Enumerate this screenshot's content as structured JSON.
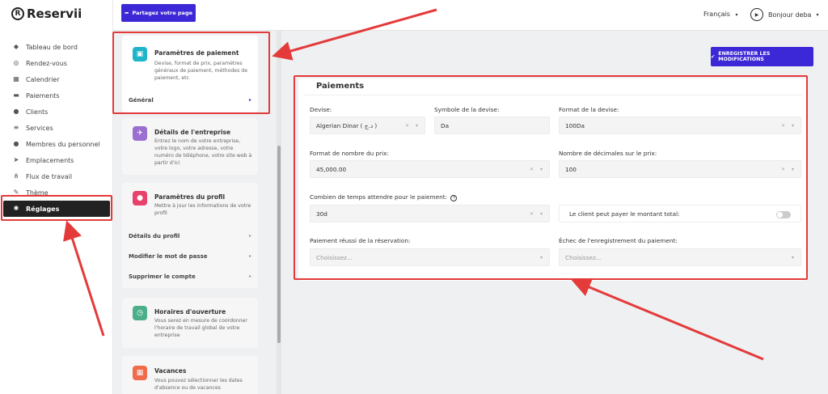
{
  "app": {
    "logo_text": "Reservii",
    "logo_mark": "R"
  },
  "sidebar": {
    "items": [
      {
        "label": "Tableau de bord",
        "icon": "cube-icon"
      },
      {
        "label": "Rendez-vous",
        "icon": "headset-icon"
      },
      {
        "label": "Calendrier",
        "icon": "calendar-icon"
      },
      {
        "label": "Paiements",
        "icon": "card-icon"
      },
      {
        "label": "Clients",
        "icon": "users-icon"
      },
      {
        "label": "Services",
        "icon": "list-icon"
      },
      {
        "label": "Membres du personnel",
        "icon": "user-icon"
      },
      {
        "label": "Emplacements",
        "icon": "location-icon"
      },
      {
        "label": "Flux de travail",
        "icon": "flow-icon"
      },
      {
        "label": "Thème",
        "icon": "brush-icon"
      },
      {
        "label": "Réglages",
        "icon": "gear-icon",
        "active": true
      }
    ]
  },
  "topbar": {
    "share_label": "Partagez votre page",
    "language": "Français",
    "greeting": "Bonjour deba"
  },
  "settings": {
    "payment": {
      "title": "Paramètres de paiement",
      "desc": "Devise, format de prix, paramètres généraux de paiement, méthodes de paiement, etc",
      "sub": "Général"
    },
    "company": {
      "title": "Détails de l'entreprise",
      "desc": "Entrez le nom de votre entreprise, votre logo, votre adresse, votre numéro de téléphone, votre site web à partir d'ici"
    },
    "profile": {
      "title": "Paramètres du profil",
      "desc": "Mettre à jour les informations de votre profil",
      "subs": [
        "Détails du profil",
        "Modifier le mot de passe",
        "Supprimer le compte"
      ]
    },
    "hours": {
      "title": "Horaires d'ouverture",
      "desc": "Vous serez en mesure de coordonner l'horaire de travail global de votre entreprise"
    },
    "vacation": {
      "title": "Vacances",
      "desc": "Vous pouvez sélectionner les dates d'absence ou de vacances"
    }
  },
  "main": {
    "save_label": "ENREGISTRER LES MODIFICATIONS",
    "panel_title": "Paiements",
    "fields": {
      "currency": {
        "label": "Devise:",
        "value": "Algerian Dinar ( د.ج )"
      },
      "symbol": {
        "label": "Symbole de la devise:",
        "value": "Da"
      },
      "format": {
        "label": "Format de la devise:",
        "value": "100Da"
      },
      "number_format": {
        "label": "Format de nombre du prix:",
        "value": "45,000.00"
      },
      "decimals": {
        "label": "Nombre de décimales sur le prix:",
        "value": "100"
      },
      "wait_time": {
        "label": "Combien de temps attendre pour le paiement:",
        "value": "30d"
      },
      "full_payment": {
        "label": "Le client peut payer le montant total:",
        "enabled": false
      },
      "success": {
        "label": "Paiement réussi de la réservation:",
        "placeholder": "Choisissez..."
      },
      "failure": {
        "label": "Échec de l'enregistrement du paiement:",
        "placeholder": "Choisissez..."
      }
    }
  },
  "colors": {
    "accent": "#3c28d6",
    "annotation": "#e43a3a",
    "active_nav": "#222222"
  }
}
